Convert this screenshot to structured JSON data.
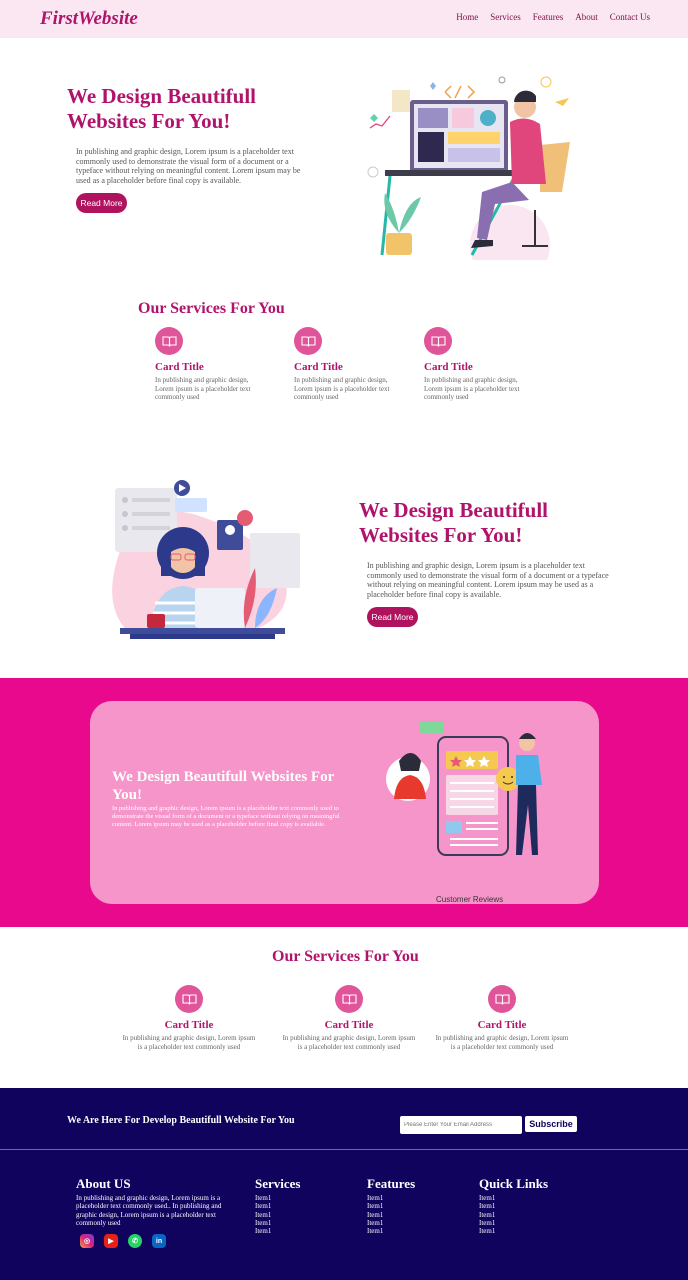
{
  "brand": "FirstWebsite",
  "nav": [
    "Home",
    "Services",
    "Features",
    "About",
    "Contact Us"
  ],
  "hero1": {
    "title": "We Design Beautifull Websites For You!",
    "text": "In publishing and graphic design, Lorem ipsum is a placeholder text commonly used to demonstrate the visual form of a document or a typeface without relying on meaningful content. Lorem ipsum may be used as a placeholder before final copy is available.",
    "button": "Read More"
  },
  "services1": {
    "title": "Our Services For You",
    "cards": [
      {
        "title": "Card Title",
        "text": "In publishing and graphic design, Lorem ipsum is a placeholder text commonly used"
      },
      {
        "title": "Card Title",
        "text": "In publishing and graphic design, Lorem ipsum is a placeholder text commonly used"
      },
      {
        "title": "Card Title",
        "text": "In publishing and graphic design, Lorem ipsum is a placeholder text commonly used"
      }
    ]
  },
  "hero2": {
    "title": "We Design Beautifull Websites For You!",
    "text": "In publishing and graphic design, Lorem ipsum is a placeholder text commonly used to demonstrate the visual form of a document or a typeface without relying on meaningful content. Lorem ipsum may be used as a placeholder before final copy is available.",
    "button": "Read More"
  },
  "pink": {
    "title": "We Design Beautifull Websites For You!",
    "text": "In publishing and graphic design, Lorem ipsum is a placeholder text commonly used to demonstrate the visual form of a document or a typeface without relying on meaningful content. Lorem ipsum may be used as a placeholder before final copy is available.",
    "caption": "Customer Reviews"
  },
  "services2": {
    "title": "Our Services For You",
    "cards": [
      {
        "title": "Card Title",
        "text": "In publishing and graphic design, Lorem ipsum is a placeholder text commonly used"
      },
      {
        "title": "Card Title",
        "text": "In publishing and graphic design, Lorem ipsum is a placeholder text commonly used"
      },
      {
        "title": "Card Title",
        "text": "In publishing and graphic design, Lorem ipsum is a placeholder text commonly used"
      }
    ]
  },
  "cta": {
    "text": "We Are Here For Develop Beautifull Website For You",
    "placeholder": "Please Enter Your Email Address",
    "button": "Subscribe"
  },
  "footer": {
    "about": {
      "title": "About US",
      "text": "In publishing and graphic design, Lorem ipsum is a placeholder text commonly used.. In publishing and graphic design, Lorem ipsum is a placeholder text commonly used"
    },
    "services": {
      "title": "Services",
      "items": [
        "Item1",
        "Item1",
        "Item1",
        "Item1",
        "Item1"
      ]
    },
    "features": {
      "title": "Features",
      "items": [
        "Item1",
        "Item1",
        "Item1",
        "Item1",
        "Item1"
      ]
    },
    "quick": {
      "title": "Quick Links",
      "items": [
        "Item1",
        "Item1",
        "Item1",
        "Item1",
        "Item1"
      ]
    },
    "social_icons": [
      "instagram-icon",
      "youtube-icon",
      "whatsapp-icon",
      "linkedin-icon"
    ]
  },
  "colors": {
    "brand": "#b0136b",
    "pink_band": "#e8098d",
    "pink_card": "#f695c9",
    "navy": "#0f035e",
    "card_icon": "#e0549a"
  }
}
